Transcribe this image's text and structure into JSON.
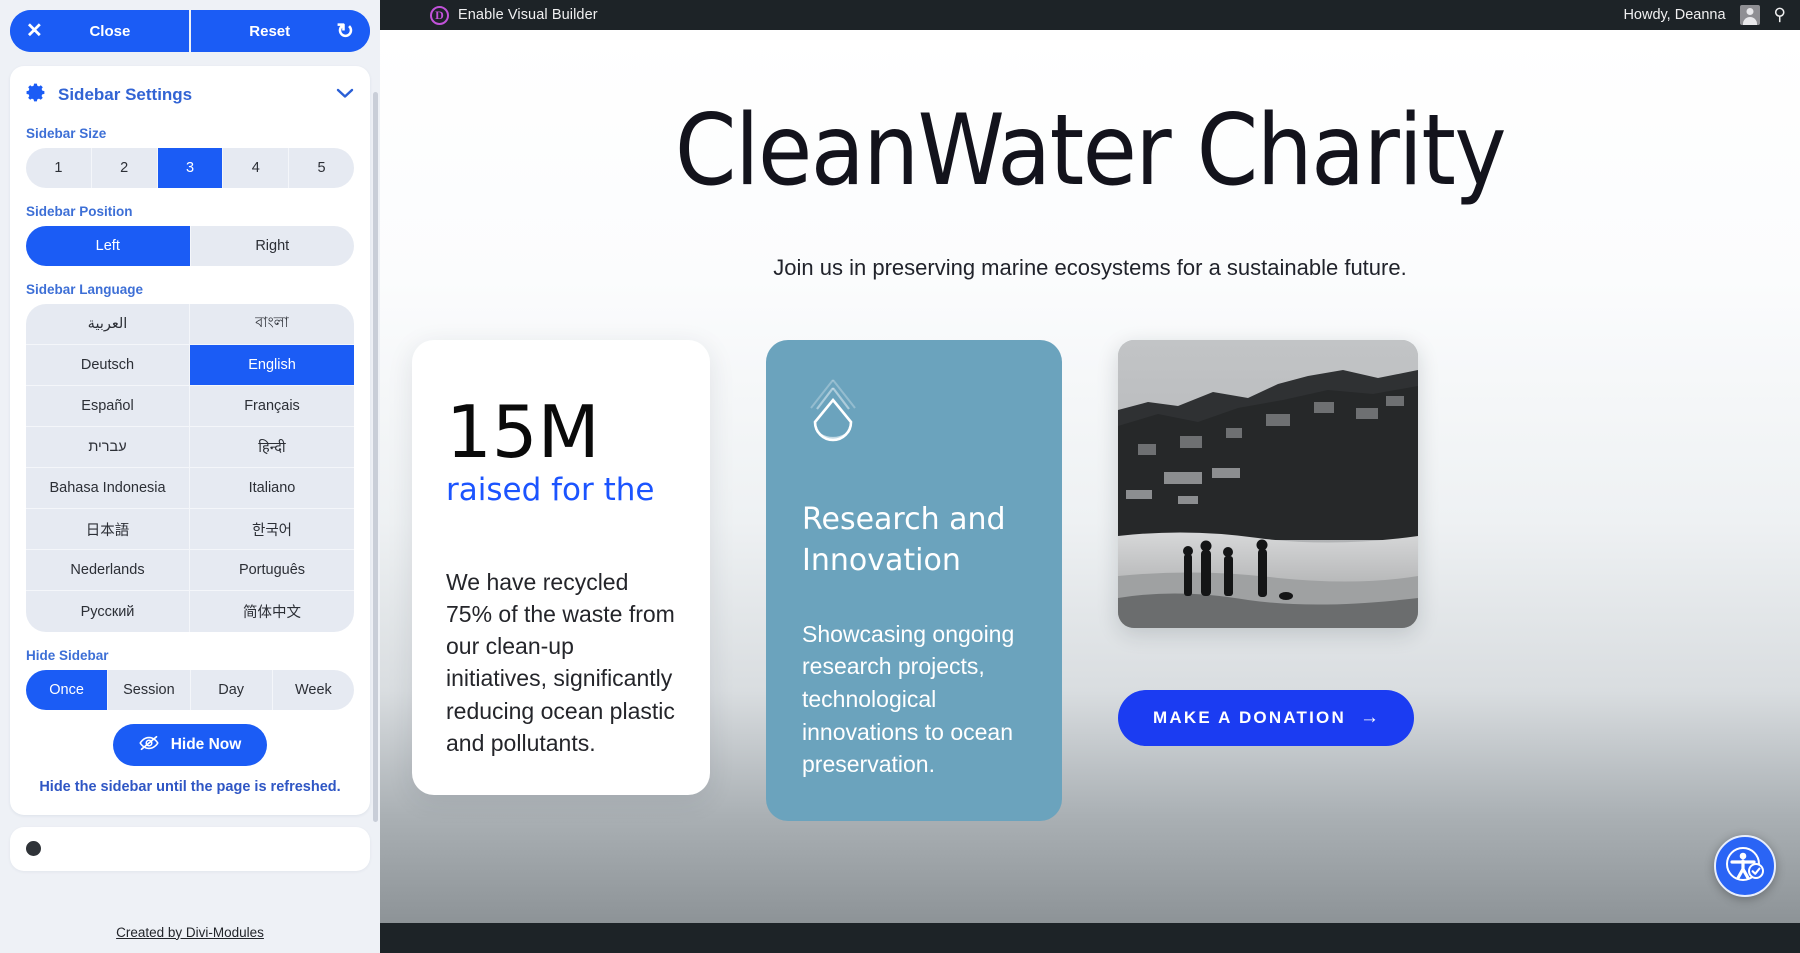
{
  "adminbar": {
    "divi_badge": "D",
    "visual_builder_label": "Enable Visual Builder",
    "howdy": "Howdy, Deanna",
    "avatar_icon": "user-avatar-icon",
    "search_icon": "search-icon"
  },
  "site": {
    "hero_title": "CleanWater Charity",
    "hero_subtitle": "Join us in preserving marine ecosystems for a sustainable future.",
    "stat_card": {
      "number": "15M",
      "caption": "raised for the",
      "body": "We have recycled 75% of the waste from our clean-up initiatives, significantly reducing ocean plastic and pollutants."
    },
    "research_card": {
      "icon": "water-drop-icon",
      "title": "Research and Innovation",
      "body": "Showcasing ongoing research projects, technological innovations to ocean preservation."
    },
    "photo_card": {
      "image_alt": "black-and-white-beach-coastline-photo"
    },
    "donate_button": {
      "label": "MAKE A DONATION",
      "arrow": "→"
    },
    "accessibility_widget": {
      "icon": "accessibility-icon"
    }
  },
  "sidebar_panel": {
    "close_button": "Close",
    "close_icon": "close-x-icon",
    "reset_button": "Reset",
    "reset_icon": "reset-undo-icon",
    "settings_title": "Sidebar Settings",
    "settings_icon": "gear-icon",
    "collapse_icon": "chevron-down-icon",
    "sidebar_size": {
      "label": "Sidebar Size",
      "options": [
        "1",
        "2",
        "3",
        "4",
        "5"
      ],
      "selected": "3"
    },
    "sidebar_position": {
      "label": "Sidebar Position",
      "options": [
        "Left",
        "Right"
      ],
      "selected": "Left"
    },
    "sidebar_language": {
      "label": "Sidebar Language",
      "options": [
        "العربية",
        "বাংলা",
        "Deutsch",
        "English",
        "Español",
        "Français",
        "עברית",
        "हिन्दी",
        "Bahasa Indonesia",
        "Italiano",
        "日本語",
        "한국어",
        "Nederlands",
        "Português",
        "Русский",
        "简体中文"
      ],
      "selected": "English"
    },
    "hide_sidebar": {
      "label": "Hide Sidebar",
      "options": [
        "Once",
        "Session",
        "Day",
        "Week"
      ],
      "selected": "Once"
    },
    "hide_now_button": "Hide Now",
    "hide_now_icon": "eye-slash-icon",
    "hide_hint": "Hide the sidebar until the page is refreshed.",
    "footer_link": "Created by Divi-Modules"
  },
  "colors": {
    "accent_blue": "#1b5cf5",
    "donate_blue": "#1b3cf2",
    "research_card": "#6ba3bd",
    "adminbar": "#1d2327",
    "divi_purple": "#c152d9",
    "segment_bg": "#e6eaf2"
  }
}
